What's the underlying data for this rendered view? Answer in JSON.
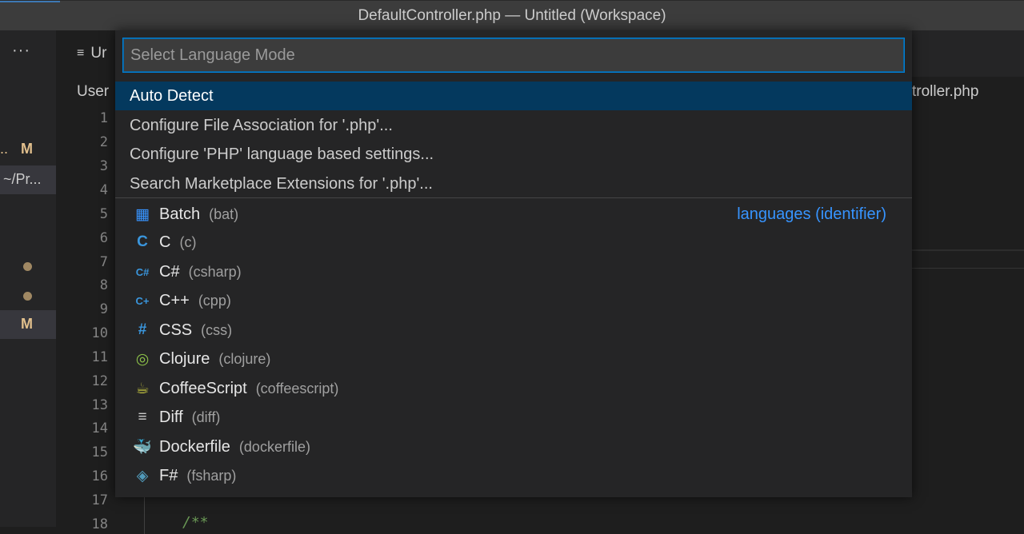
{
  "window": {
    "title": "DefaultController.php — Untitled (Workspace)"
  },
  "sidebar": {
    "more_label": "···",
    "rows": [
      {
        "left": "..",
        "badge": "M"
      },
      {
        "path": "~/Pr..."
      },
      {
        "dot": true
      },
      {
        "dot": true
      },
      {
        "badge": "M"
      }
    ]
  },
  "editor": {
    "tab_label": "Ur",
    "breadcrumb_left": "User",
    "breadcrumb_right": "troller.php",
    "line_numbers": [
      "1",
      "2",
      "3",
      "4",
      "5",
      "6",
      "7",
      "8",
      "9",
      "10",
      "11",
      "12",
      "13",
      "14",
      "15",
      "16",
      "17",
      "18"
    ],
    "code_tail": "/**"
  },
  "quickpick": {
    "placeholder": "Select Language Mode",
    "actions": [
      "Auto Detect",
      "Configure File Association for '.php'...",
      "Configure 'PHP' language based settings...",
      "Search Marketplace Extensions for '.php'..."
    ],
    "detail_label": "languages (identifier)",
    "languages": [
      {
        "name": "Batch",
        "id": "(bat)",
        "icon": "windows-icon",
        "glyph": "▦",
        "color": "#3794ff"
      },
      {
        "name": "C",
        "id": "(c)",
        "icon": "c-icon",
        "glyph": "C",
        "color": "#3a96dd"
      },
      {
        "name": "C#",
        "id": "(csharp)",
        "icon": "csharp-icon",
        "glyph": "C#",
        "color": "#3a96dd"
      },
      {
        "name": "C++",
        "id": "(cpp)",
        "icon": "cpp-icon",
        "glyph": "C+",
        "color": "#3a96dd"
      },
      {
        "name": "CSS",
        "id": "(css)",
        "icon": "css-hash-icon",
        "glyph": "#",
        "color": "#3a96dd"
      },
      {
        "name": "Clojure",
        "id": "(clojure)",
        "icon": "clojure-icon",
        "glyph": "◎",
        "color": "#8dc149"
      },
      {
        "name": "CoffeeScript",
        "id": "(coffeescript)",
        "icon": "coffee-cup-icon",
        "glyph": "☕",
        "color": "#cbcb41"
      },
      {
        "name": "Diff",
        "id": "(diff)",
        "icon": "lines-icon",
        "glyph": "≡",
        "color": "#cccccc"
      },
      {
        "name": "Dockerfile",
        "id": "(dockerfile)",
        "icon": "docker-whale-icon",
        "glyph": "🐳",
        "color": "#519aba"
      },
      {
        "name": "F#",
        "id": "(fsharp)",
        "icon": "fsharp-icon",
        "glyph": "◈",
        "color": "#519aba"
      }
    ]
  }
}
